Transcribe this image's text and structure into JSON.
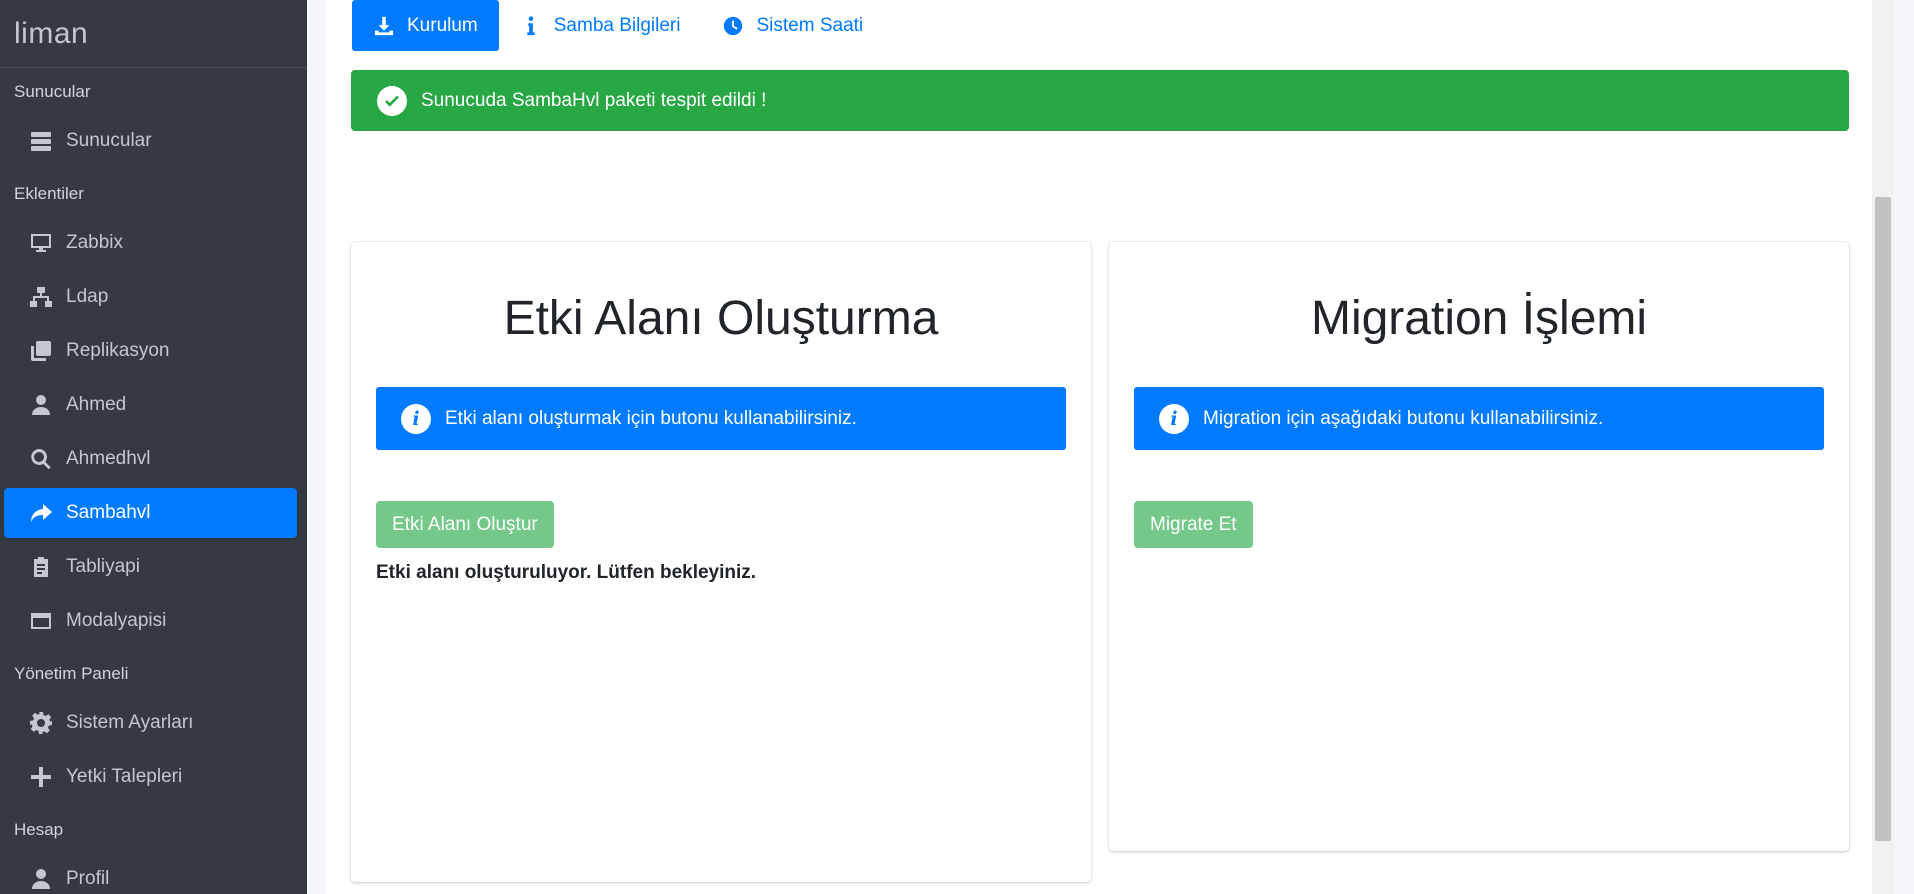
{
  "brand": {
    "name": "liman"
  },
  "sidebar": {
    "sections": [
      {
        "header": "Sunucular",
        "items": [
          {
            "label": "Sunucular",
            "icon": "server-icon"
          }
        ]
      },
      {
        "header": "Eklentiler",
        "items": [
          {
            "label": "Zabbix",
            "icon": "desktop-icon"
          },
          {
            "label": "Ldap",
            "icon": "sitemap-icon"
          },
          {
            "label": "Replikasyon",
            "icon": "clone-icon"
          },
          {
            "label": "Ahmed",
            "icon": "user-icon"
          },
          {
            "label": "Ahmedhvl",
            "icon": "search-icon"
          },
          {
            "label": "Sambahvl",
            "icon": "share-icon",
            "active": true
          },
          {
            "label": "Tabliyapi",
            "icon": "clipboard-icon"
          },
          {
            "label": "Modalyapisi",
            "icon": "window-icon"
          }
        ]
      },
      {
        "header": "Yönetim Paneli",
        "items": [
          {
            "label": "Sistem Ayarları",
            "icon": "gear-icon"
          },
          {
            "label": "Yetki Talepleri",
            "icon": "plus-icon"
          }
        ]
      },
      {
        "header": "Hesap",
        "items": [
          {
            "label": "Profil",
            "icon": "user-icon"
          }
        ]
      }
    ]
  },
  "tabs": [
    {
      "label": "Kurulum",
      "icon": "download-icon",
      "active": true
    },
    {
      "label": "Samba Bilgileri",
      "icon": "info-icon"
    },
    {
      "label": "Sistem Saati",
      "icon": "clock-icon"
    }
  ],
  "success_alert": {
    "text": "Sunucuda SambaHvl paketi tespit edildi !"
  },
  "cards": {
    "domain": {
      "title": "Etki Alanı Oluşturma",
      "info": "Etki alanı oluşturmak için butonu kullanabilirsiniz.",
      "button": "Etki Alanı Oluştur",
      "status": "Etki alanı oluşturuluyor. Lütfen bekleyiniz."
    },
    "migration": {
      "title": "Migration İşlemi",
      "info": "Migration için aşağıdaki butonu kullanabilirsiniz.",
      "button": "Migrate Et"
    }
  },
  "colors": {
    "primary": "#007bff",
    "success": "#28a745",
    "sidebar": "#343a40",
    "disabled_button": "#74c88a"
  }
}
